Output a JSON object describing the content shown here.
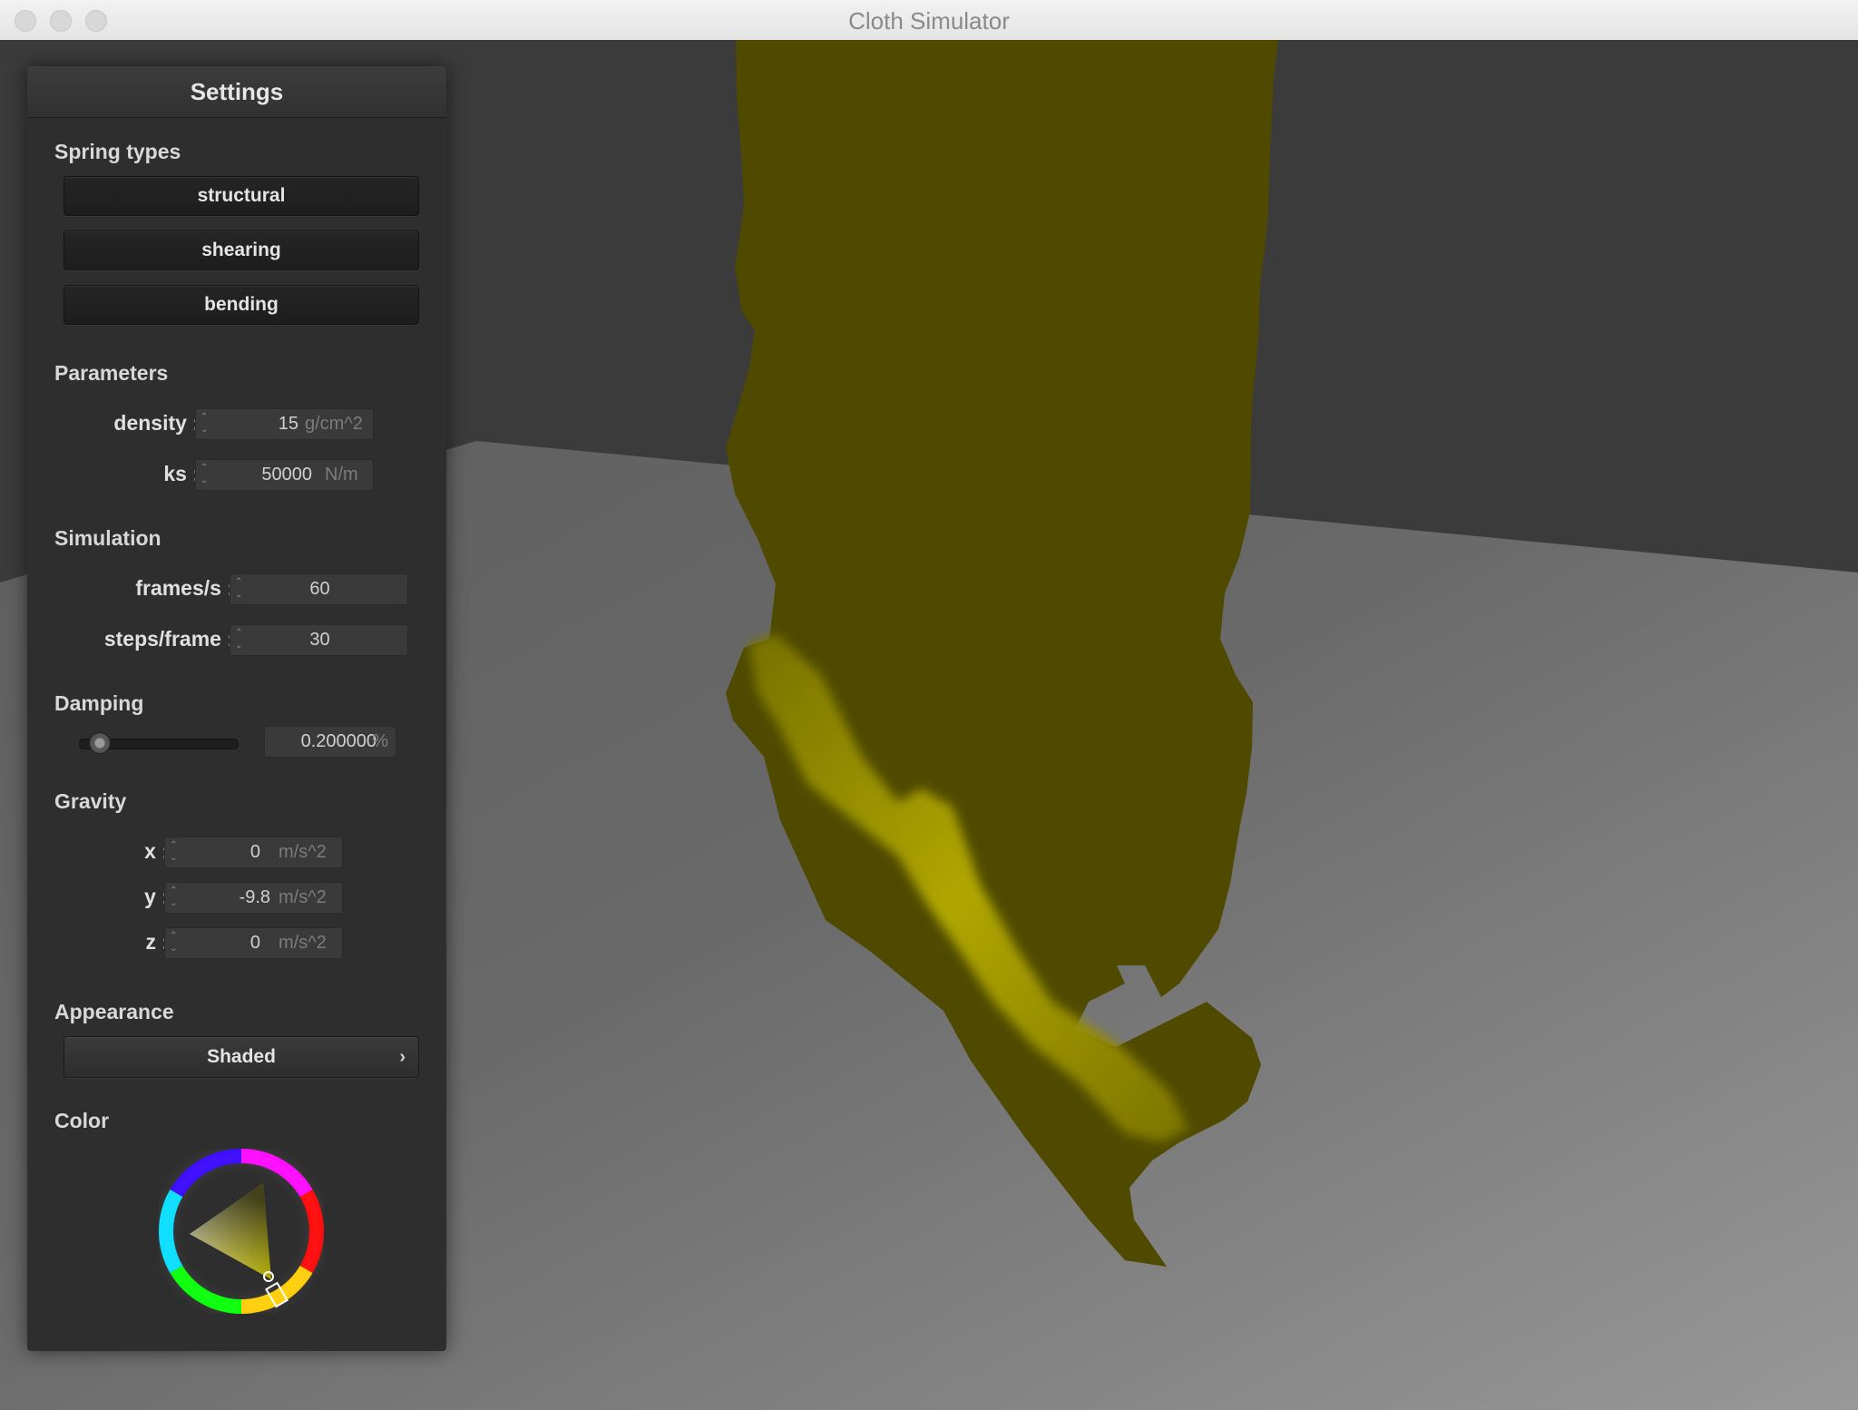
{
  "window": {
    "title": "Cloth Simulator"
  },
  "settings": {
    "title": "Settings",
    "spring_types": {
      "heading": "Spring types",
      "buttons": [
        "structural",
        "shearing",
        "bending"
      ]
    },
    "parameters": {
      "heading": "Parameters",
      "density": {
        "label": "density :",
        "value": "15",
        "unit": "g/cm^2"
      },
      "ks": {
        "label": "ks :",
        "value": "50000",
        "unit": "N/m"
      }
    },
    "simulation": {
      "heading": "Simulation",
      "fps": {
        "label": "frames/s :",
        "value": "60"
      },
      "steps": {
        "label": "steps/frame :",
        "value": "30"
      }
    },
    "damping": {
      "heading": "Damping",
      "value": "0.200000",
      "unit": "%",
      "slider_fraction": 0.13
    },
    "gravity": {
      "heading": "Gravity",
      "x": {
        "label": "x :",
        "value": "0",
        "unit": "m/s^2"
      },
      "y": {
        "label": "y :",
        "value": "-9.8",
        "unit": "m/s^2"
      },
      "z": {
        "label": "z :",
        "value": "0",
        "unit": "m/s^2"
      }
    },
    "appearance": {
      "heading": "Appearance",
      "mode": "Shaded"
    },
    "color": {
      "heading": "Color",
      "selected": "#c8c000"
    }
  },
  "scene": {
    "background": "#3b3b3b",
    "floor": "#787878",
    "cloth": "#4f4a00",
    "cloth_highlight": "#b8b000"
  }
}
